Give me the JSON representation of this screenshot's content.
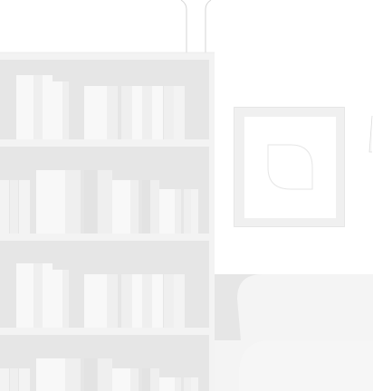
{
  "illustration": {
    "subject": "living-room-placeholder",
    "colors": {
      "background": "#ffffff",
      "frame": "#f3f3f3",
      "shelf_back": "#e6e6e6",
      "book_light": "#f8f8f8",
      "book_mid": "#efefef",
      "book_dark": "#e3e3e3",
      "sofa": "#f4f4f4",
      "sofa_shadow": "#e6e6e6",
      "line": "#dcdcdc"
    }
  }
}
